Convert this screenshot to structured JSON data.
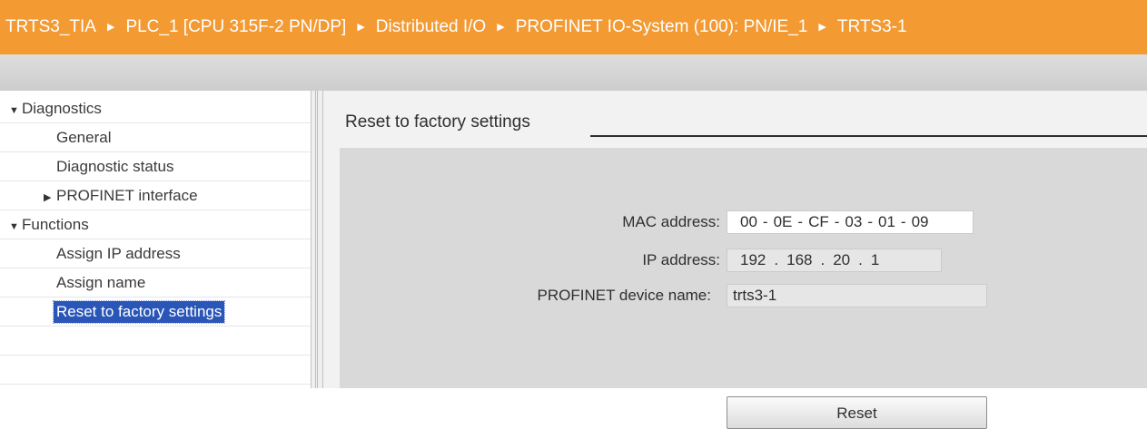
{
  "breadcrumb": [
    "TRTS3_TIA",
    "PLC_1 [CPU 315F-2 PN/DP]",
    "Distributed I/O",
    "PROFINET IO-System (100): PN/IE_1",
    "TRTS3-1"
  ],
  "breadcrumb_separator_icon": "triangle-right-icon",
  "nav": {
    "diagnostics": "Diagnostics",
    "general": "General",
    "diagnostic_status": "Diagnostic status",
    "profinet_interface": "PROFINET interface",
    "functions": "Functions",
    "assign_ip": "Assign IP address",
    "assign_name": "Assign name",
    "reset_factory": "Reset to factory settings"
  },
  "section": {
    "title": "Reset to factory settings"
  },
  "form": {
    "mac_label": "MAC address:",
    "mac": [
      "00",
      "0E",
      "CF",
      "03",
      "01",
      "09"
    ],
    "ip_label": "IP address:",
    "ip": [
      "192",
      "168",
      "20",
      "1"
    ],
    "name_label": "PROFINET device name:",
    "name_value": "trts3-1",
    "reset_label": "Reset"
  },
  "colors": {
    "header": "#f39a33",
    "selection": "#2a56b8",
    "panel": "#d9d9d9"
  }
}
